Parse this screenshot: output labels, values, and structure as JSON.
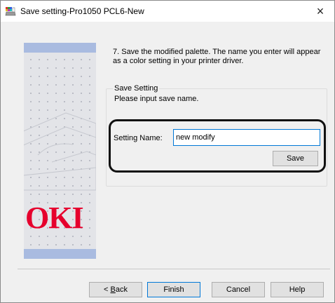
{
  "window": {
    "title": "Save setting-Pro1050 PCL6-New",
    "close_glyph": "×"
  },
  "side_panel": {
    "logo_text": "OKI",
    "logo_color": "#e6002d",
    "band_color": "#a9bbe0"
  },
  "instruction_text": "7. Save the modified palette.  The name you enter will appear as a color setting in your printer driver.",
  "save_group": {
    "title": "Save Setting",
    "description": "Please input save name.",
    "field_label": "Setting Name:",
    "field_value": "new modify",
    "save_label": "Save"
  },
  "buttons": {
    "back_prefix": "< ",
    "back_accel": "B",
    "back_rest": "ack",
    "finish": "Finish",
    "cancel": "Cancel",
    "help": "Help"
  },
  "colors": {
    "accent": "#0078d7",
    "highlight_border": "#111111"
  },
  "icons": {
    "title_icon": "printer-palette-icon",
    "close_icon": "close-icon"
  }
}
